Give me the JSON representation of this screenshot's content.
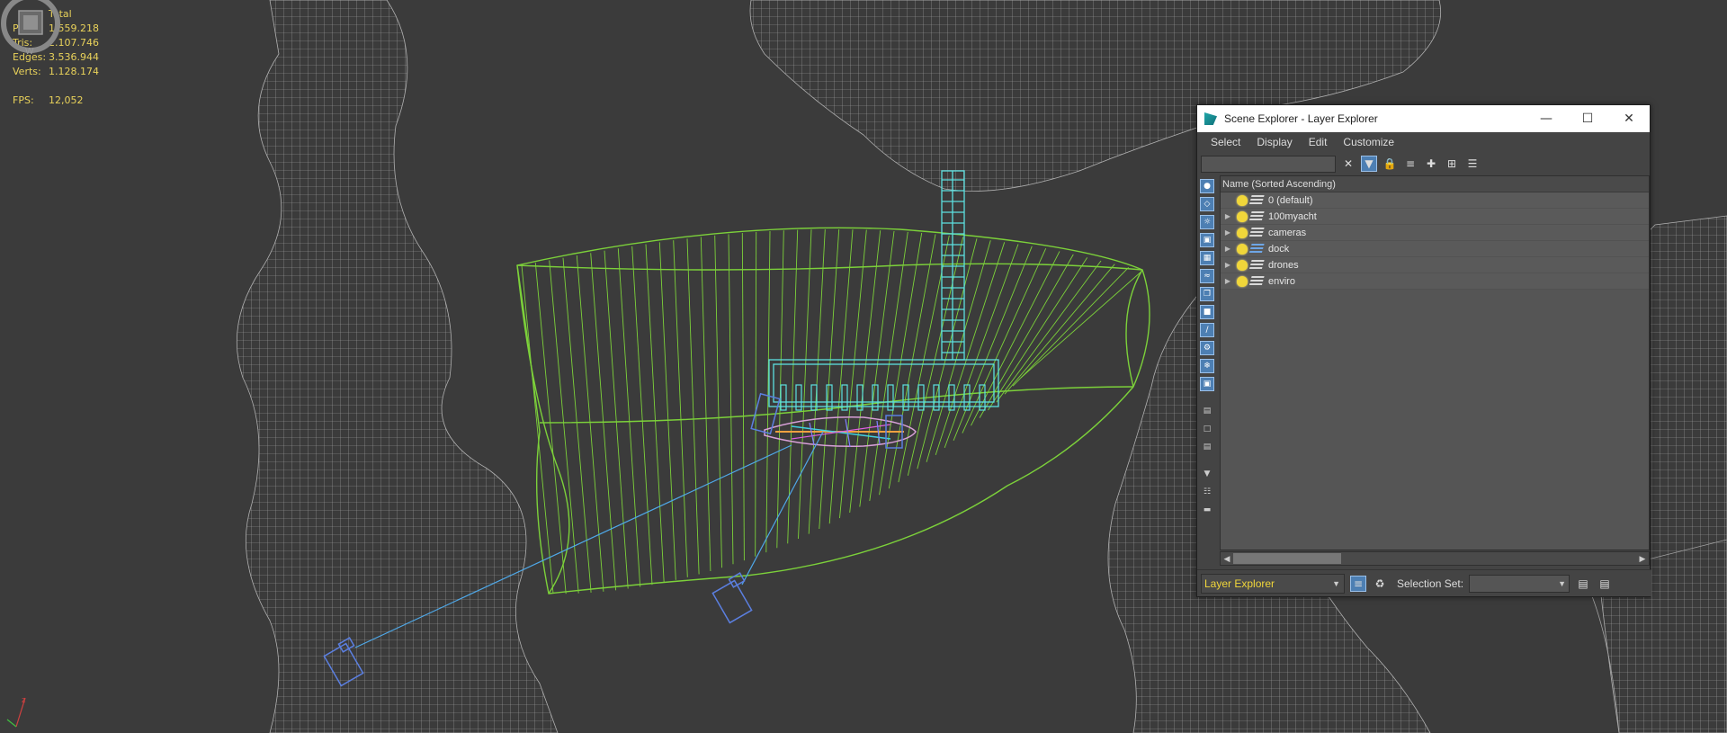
{
  "viewport": {
    "stats": {
      "header": "Total",
      "rows": [
        {
          "label": "Polys:",
          "value": "1.559.218"
        },
        {
          "label": "Tris:",
          "value": "2.107.746"
        },
        {
          "label": "Edges:",
          "value": "3.536.944"
        },
        {
          "label": "Verts:",
          "value": "1.128.174"
        }
      ],
      "fps_label": "FPS:",
      "fps_value": "12,052"
    },
    "colors": {
      "background": "#3b3b3b",
      "terrain_wire": "#a8a8a8",
      "water_wire": "#7cd13a",
      "dock_wire": "#5ce0e0",
      "camera_wire": "#5b7fe0"
    }
  },
  "scene_explorer": {
    "title": "Scene Explorer - Layer Explorer",
    "window_buttons": [
      "minimize-icon",
      "maximize-icon",
      "close-icon"
    ],
    "menu": [
      "Select",
      "Display",
      "Edit",
      "Customize"
    ],
    "search_value": "",
    "column_header": "Name (Sorted Ascending)",
    "layers": [
      {
        "name": "0 (default)",
        "expandable": false,
        "active": false
      },
      {
        "name": "100myacht",
        "expandable": true,
        "active": false
      },
      {
        "name": "cameras",
        "expandable": true,
        "active": false
      },
      {
        "name": "dock",
        "expandable": true,
        "active": true
      },
      {
        "name": "drones",
        "expandable": true,
        "active": false
      },
      {
        "name": "enviro",
        "expandable": true,
        "active": false
      }
    ],
    "explorer_mode": "Layer Explorer",
    "selection_set_label": "Selection Set:",
    "selection_set_value": ""
  }
}
